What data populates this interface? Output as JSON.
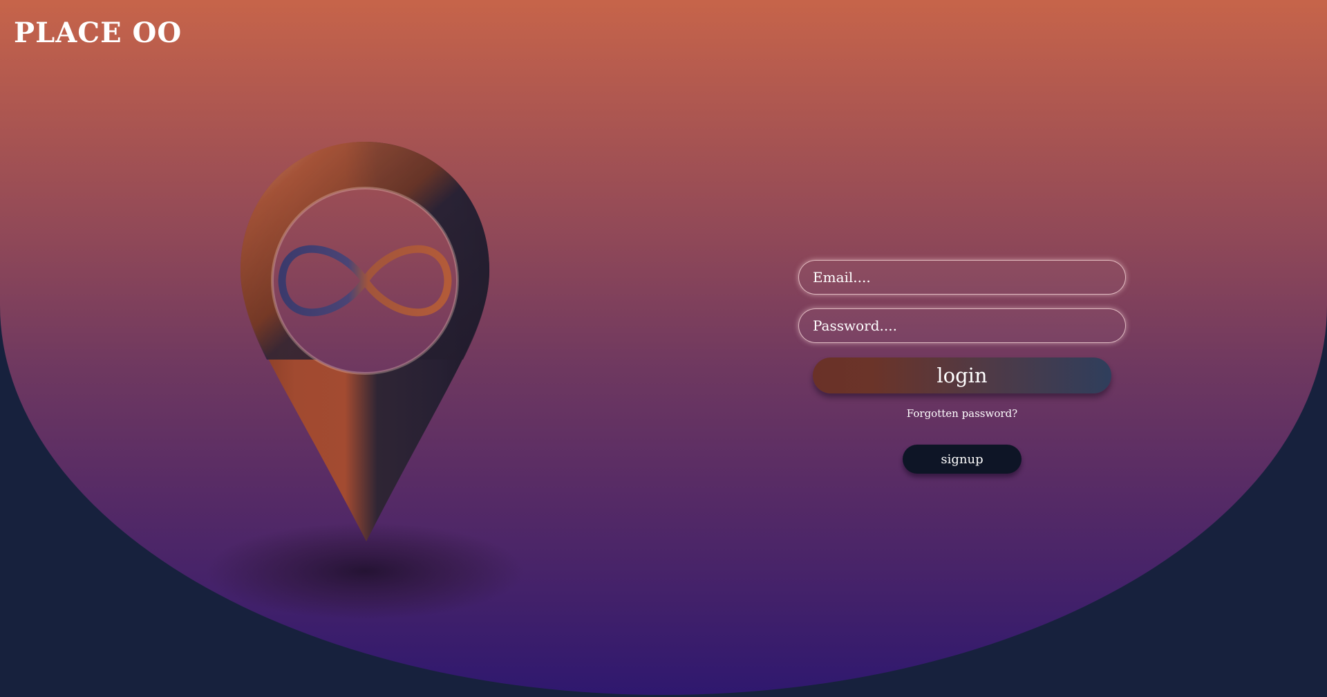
{
  "page": {
    "background_color": "#17213d",
    "gradient_colors": [
      "#c6644a",
      "#8f4858",
      "#552a66",
      "#2f186f"
    ]
  },
  "header": {
    "brand": "PLACE OO"
  },
  "hero": {
    "icon": "map-pin-infinity-icon",
    "colors": {
      "copper": "#a14a30",
      "dark": "#2a2235",
      "infinity_blue": "#434274",
      "infinity_copper": "#b35b39"
    }
  },
  "login_form": {
    "email_placeholder": "Email....",
    "password_placeholder": "Password....",
    "login_label": "login",
    "forgot_password_label": "Forgotten password?",
    "signup_label": "signup"
  }
}
